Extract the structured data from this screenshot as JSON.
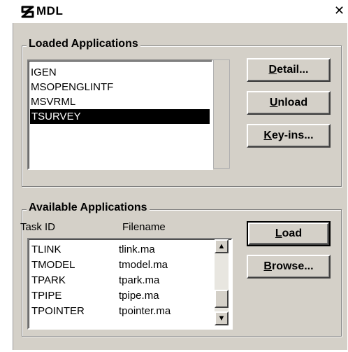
{
  "window": {
    "title": "MDL",
    "close_glyph": "✕"
  },
  "loaded": {
    "group_label": "Loaded Applications",
    "items": [
      "IGEN",
      "MSOPENGLINTF",
      "MSVRML",
      "TSURVEY"
    ],
    "selected": "TSURVEY",
    "buttons": {
      "detail": "Detail...",
      "unload": "Unload",
      "keyins": "Key-ins..."
    }
  },
  "available": {
    "group_label": "Available Applications",
    "col_task_id": "Task ID",
    "col_filename": "Filename",
    "rows": [
      {
        "task": "TLINK",
        "file": "tlink.ma"
      },
      {
        "task": "TMODEL",
        "file": "tmodel.ma"
      },
      {
        "task": "TPARK",
        "file": "tpark.ma"
      },
      {
        "task": "TPIPE",
        "file": "tpipe.ma"
      },
      {
        "task": "TPOINTER",
        "file": "tpointer.ma"
      }
    ],
    "buttons": {
      "load": "Load",
      "browse": "Browse..."
    },
    "icons": {
      "scroll_up": "up-arrow-icon",
      "scroll_down": "down-arrow-icon",
      "app": "microstation-icon"
    }
  }
}
